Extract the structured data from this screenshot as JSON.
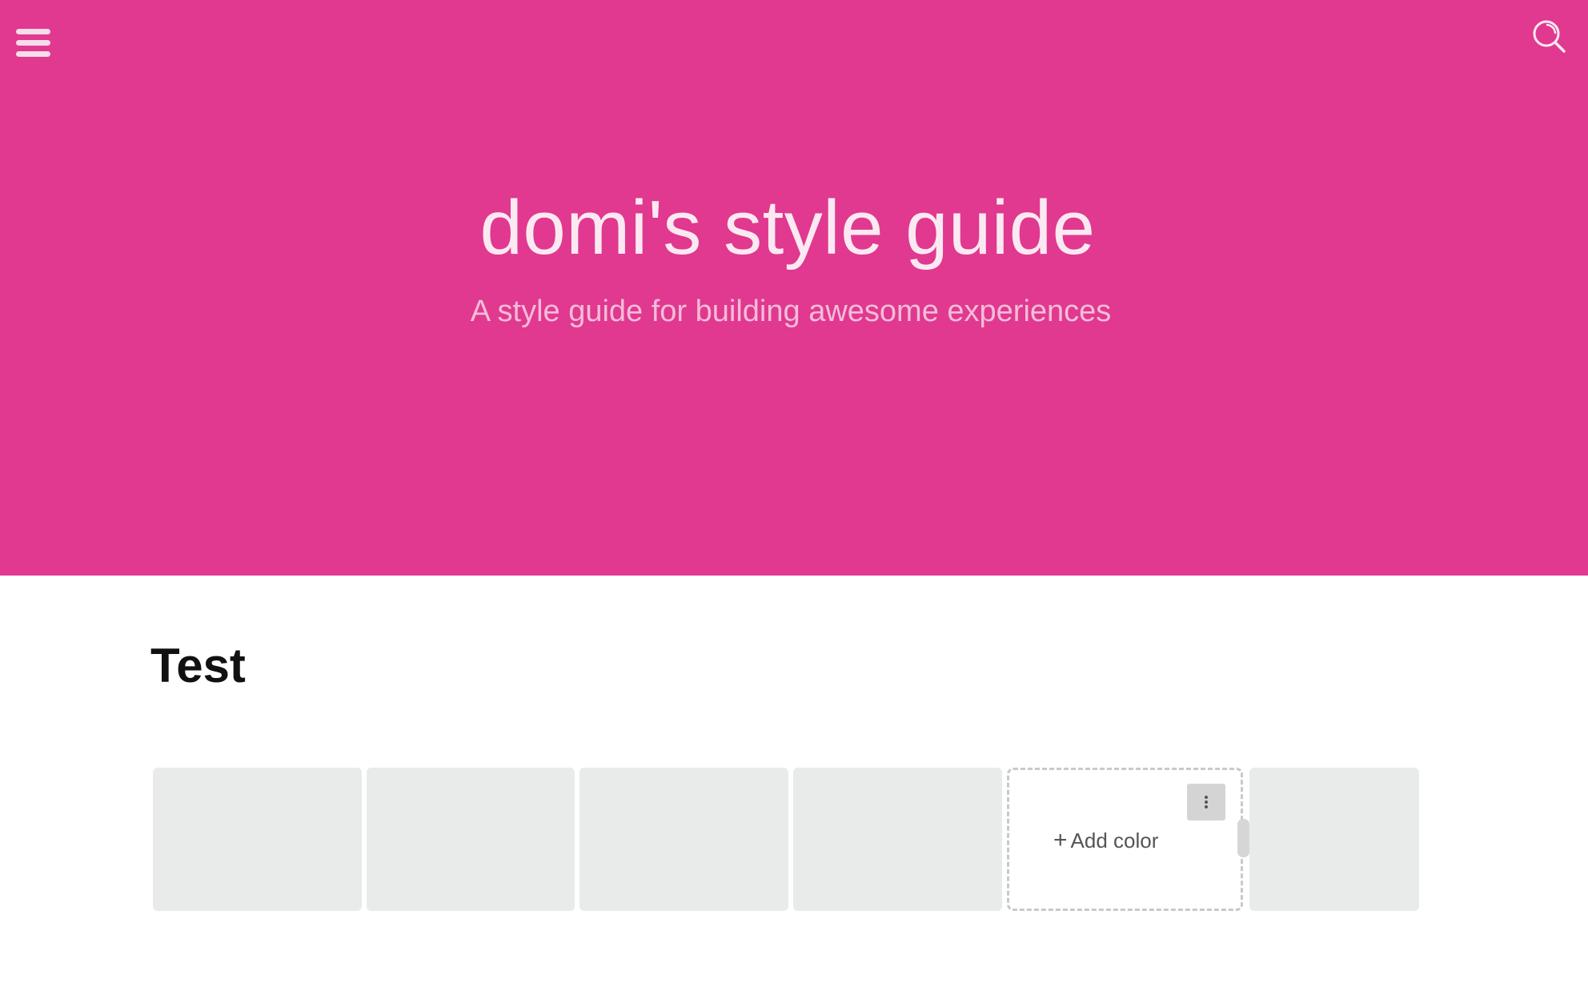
{
  "header": {
    "menu_icon": "hamburger-menu-icon",
    "search_icon": "search-icon",
    "background_color": "#e0398f"
  },
  "hero": {
    "title": "domi's style guide",
    "subtitle": "A style guide for building awesome experiences"
  },
  "section": {
    "title": "Test",
    "swatch_color": "#e9eaea",
    "add_color": {
      "plus": "+",
      "label": "Add color",
      "more_icon": "vertical-ellipsis-icon"
    }
  }
}
